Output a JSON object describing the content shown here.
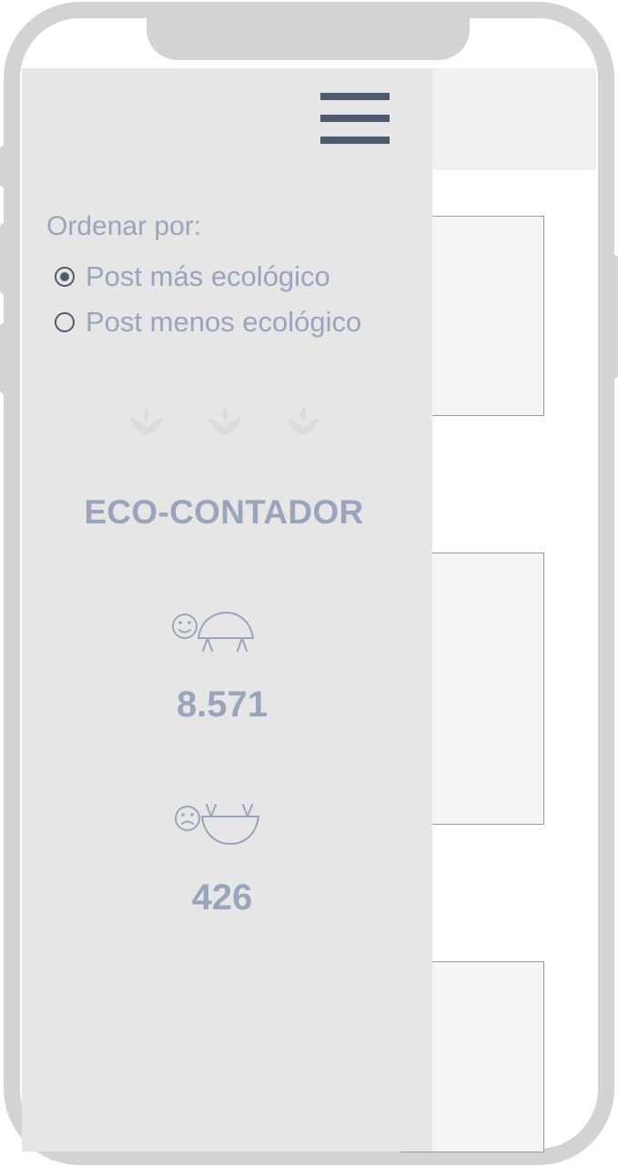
{
  "menu": {
    "icon": "hamburger-menu-icon"
  },
  "sort": {
    "label": "Ordenar por:",
    "options": [
      {
        "label": "Post más ecológico",
        "selected": true
      },
      {
        "label": "Post menos ecológico",
        "selected": false
      }
    ]
  },
  "decorations": {
    "leaf_icons": [
      "leaf-icon",
      "leaf-icon",
      "leaf-icon"
    ]
  },
  "eco_counter": {
    "title": "ECO-CONTADOR",
    "positive": {
      "icon": "happy-turtle-icon",
      "value": "8.571"
    },
    "negative": {
      "icon": "sad-upside-down-turtle-icon",
      "value": "426"
    }
  },
  "colors": {
    "drawer_bg": "#e6e6e7",
    "text_muted": "#9aa5bb",
    "dark_accent": "#4e5b6e",
    "device_frame": "#d3d3d3"
  }
}
